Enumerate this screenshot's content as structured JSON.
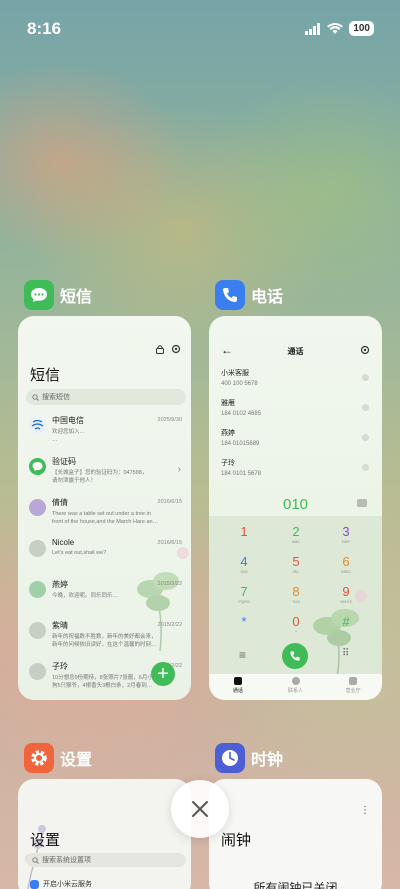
{
  "status_bar": {
    "time": "8:16",
    "battery": "100"
  },
  "apps": {
    "sms": {
      "label": "短信",
      "color": "#3fbb57"
    },
    "phone": {
      "label": "电话",
      "color": "#3b7ef0"
    },
    "settings": {
      "label": "设置",
      "color": "#f0653c"
    },
    "clock": {
      "label": "时钟",
      "color": "#4c5fd6"
    }
  },
  "sms": {
    "title": "短信",
    "search_placeholder": "搜索短信",
    "items": [
      {
        "name": "中国电信",
        "date": "2025/9/30",
        "preview": "欢迎您加入…\n…",
        "avatar_color": "#2266cc"
      },
      {
        "name": "验证码",
        "date": "",
        "preview": "【长城盒子】您的验证码为：047588，\n请勿泄露于他人！",
        "avatar_color": "#3fbb57"
      },
      {
        "name": "倩倩",
        "date": "2016/6/15",
        "preview": "There was a table set out under a tree in\nfront of the house,and the March Hare an…",
        "avatar_color": "#b9a7d6"
      },
      {
        "name": "Nicole",
        "date": "2016/6/15",
        "preview": "Let's eat out,shall we?",
        "avatar_color": "#c7cfc3"
      },
      {
        "name": "燕婷",
        "date": "2015/2/22",
        "preview": "今晚，欢迎呢。同乐同乐…",
        "avatar_color": "#9fd1a8"
      },
      {
        "name": "紫晴",
        "date": "2015/2/22",
        "preview": "新年的祝福数不胜数，新年的美好都会来，\n新年的问候依旧读好，在这个温馨的时刻…",
        "avatar_color": "#c7cfc3"
      },
      {
        "name": "子玲",
        "date": "2015/2/22",
        "preview": "10分想念9份期待，8张照片7张靓，6月小\n狗5只猴爷，4根香头3根白条，2月春到…",
        "avatar_color": "#c7cfc3"
      }
    ]
  },
  "phone": {
    "title": "通话",
    "contacts": [
      {
        "name": "小米客服",
        "number": "400 100 5678"
      },
      {
        "name": "雅雁",
        "number": "184 0102 4685"
      },
      {
        "name": "燕婷",
        "number": "184 01015689"
      },
      {
        "name": "子玲",
        "number": "184 0101 5678"
      }
    ],
    "entered": "010",
    "keys": [
      {
        "d": "1",
        "l": "",
        "c": "#e5523c"
      },
      {
        "d": "2",
        "l": "ABC",
        "c": "#3fbb57"
      },
      {
        "d": "3",
        "l": "DEF",
        "c": "#8b45d6"
      },
      {
        "d": "4",
        "l": "GHI",
        "c": "#3b7ef0"
      },
      {
        "d": "5",
        "l": "JKL",
        "c": "#e5523c"
      },
      {
        "d": "6",
        "l": "MNO",
        "c": "#e58a2b"
      },
      {
        "d": "7",
        "l": "PQRS",
        "c": "#3fbb57"
      },
      {
        "d": "8",
        "l": "TUV",
        "c": "#e58a2b"
      },
      {
        "d": "9",
        "l": "WXYZ",
        "c": "#e5523c"
      },
      {
        "d": "*",
        "l": "",
        "c": "#3b7ef0"
      },
      {
        "d": "0",
        "l": "+",
        "c": "#e5523c"
      },
      {
        "d": "#",
        "l": "",
        "c": "#3fbb57"
      }
    ],
    "tabs": [
      "通话",
      "联系人",
      "营业厅"
    ]
  },
  "settings": {
    "title": "设置",
    "search_placeholder": "搜索系统设置项",
    "first_item": "开启小米云服务"
  },
  "clock": {
    "title": "闹钟",
    "empty": "所有闹钟已关闭"
  }
}
